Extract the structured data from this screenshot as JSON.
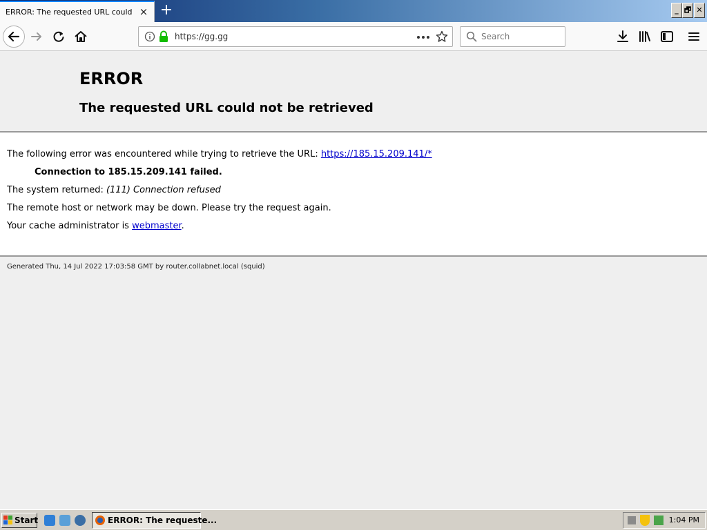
{
  "browser": {
    "tab_title": "ERROR: The requested URL could not be retrieved",
    "tab_close": "×",
    "new_tab": "+",
    "url": "https://gg.gg",
    "search_placeholder": "Search"
  },
  "window": {
    "minimize": "_",
    "restore": "🗗",
    "close": "✕"
  },
  "page": {
    "heading": "ERROR",
    "subheading": "The requested URL could not be retrieved",
    "line1_prefix": "The following error was encountered while trying to retrieve the URL: ",
    "line1_link": "https://185.15.209.141/*",
    "line2": "Connection to 185.15.209.141 failed.",
    "line3_prefix": "The system returned: ",
    "line3_em": "(111) Connection refused",
    "line4": "The remote host or network may be down. Please try the request again.",
    "line5_prefix": "Your cache administrator is ",
    "line5_link": "webmaster",
    "line5_suffix": ".",
    "footer": "Generated Thu, 14 Jul 2022 17:03:58 GMT by router.collabnet.local (squid)"
  },
  "taskbar": {
    "start_label": "Start",
    "task_label": "ERROR: The requeste...",
    "clock": "1:04 PM"
  },
  "colors": {
    "link": "#0000cc",
    "titlebar": "#0a246a",
    "lock": "#12bc00"
  }
}
